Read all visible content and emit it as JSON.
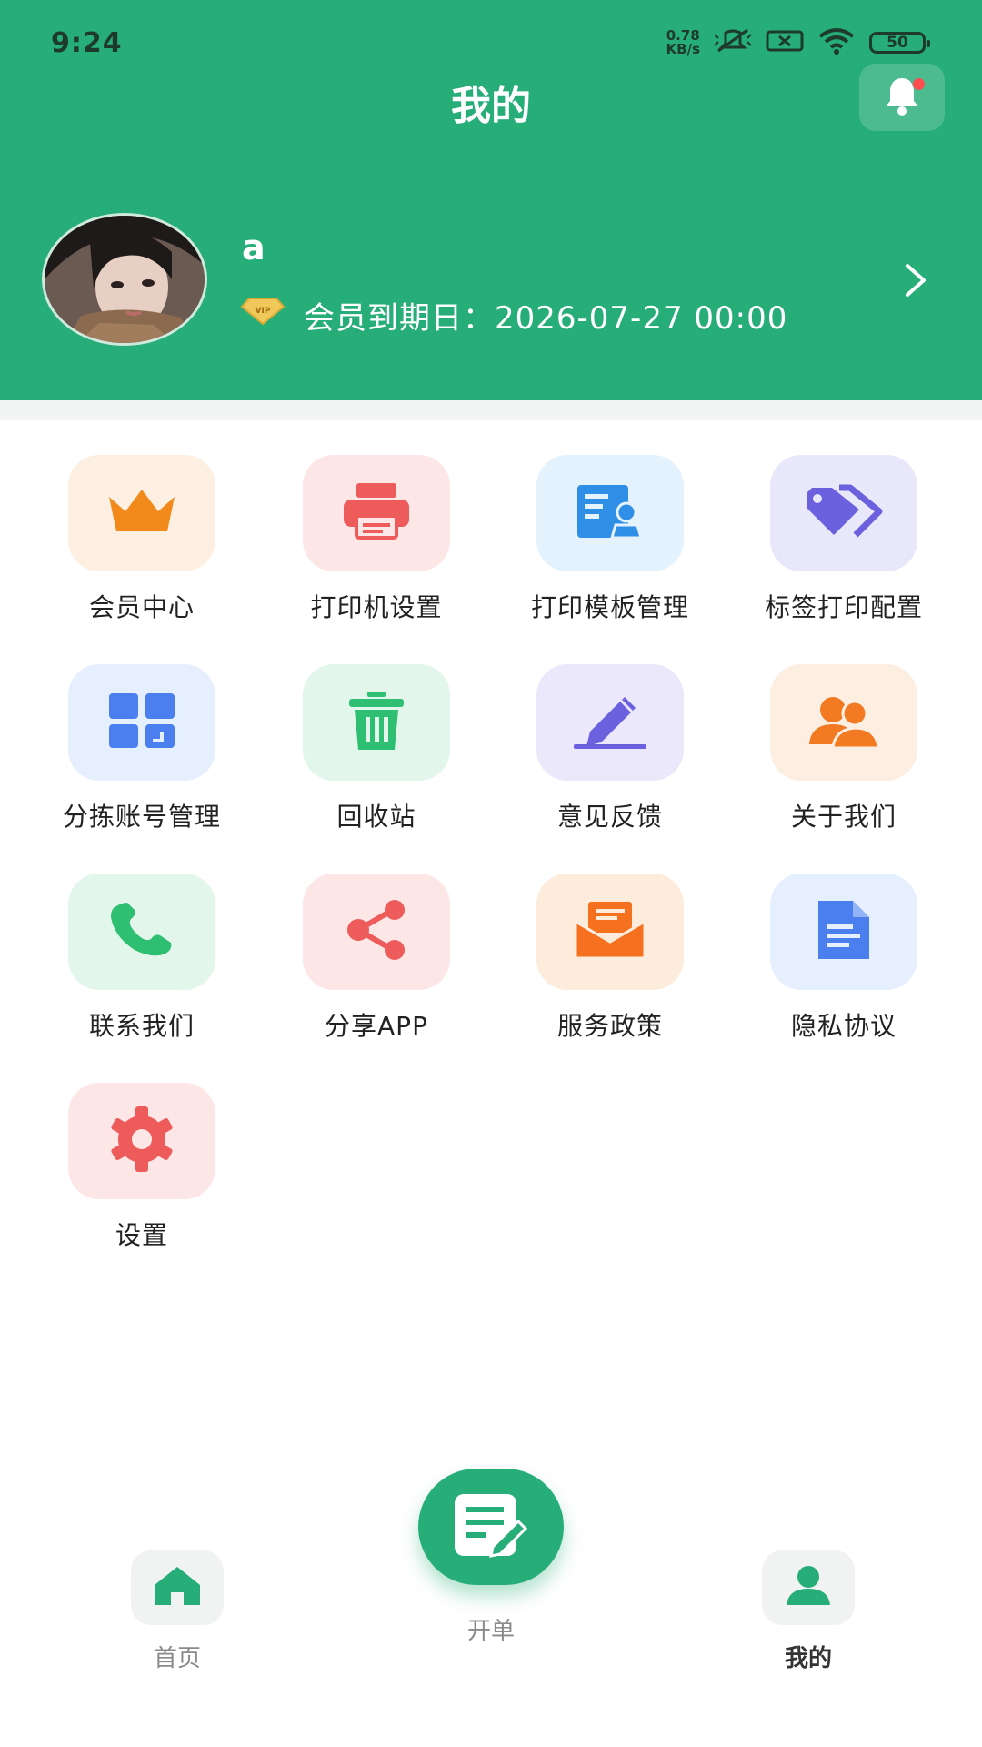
{
  "status_bar": {
    "time": "9:24",
    "net_speed_value": "0.78",
    "net_speed_unit": "KB/s",
    "battery": "50"
  },
  "header": {
    "title": "我的",
    "notification_dot": true
  },
  "profile": {
    "username": "a",
    "vip_label": "VIP",
    "member_expiry": "会员到期日：2026-07-27 00:00"
  },
  "menu": [
    {
      "label": "会员中心",
      "icon": "crown-icon",
      "tile_bg": "#fdf0e2",
      "color": "#f28a1b"
    },
    {
      "label": "打印机设置",
      "icon": "printer-icon",
      "tile_bg": "#fde6e6",
      "color": "#ee5b5b"
    },
    {
      "label": "打印模板管理",
      "icon": "template-icon",
      "tile_bg": "#e4f2fd",
      "color": "#2f8ee6"
    },
    {
      "label": "标签打印配置",
      "icon": "tags-icon",
      "tile_bg": "#e9e8fb",
      "color": "#6b61de"
    },
    {
      "label": "分拣账号管理",
      "icon": "grid-icon",
      "tile_bg": "#e6effd",
      "color": "#4b7ff0"
    },
    {
      "label": "回收站",
      "icon": "trash-icon",
      "tile_bg": "#e3f6ec",
      "color": "#2fbf72"
    },
    {
      "label": "意见反馈",
      "icon": "feedback-pen-icon",
      "tile_bg": "#ebe8fb",
      "color": "#6b61de"
    },
    {
      "label": "关于我们",
      "icon": "users-icon",
      "tile_bg": "#fdeee2",
      "color": "#f27a22"
    },
    {
      "label": "联系我们",
      "icon": "phone-icon",
      "tile_bg": "#e3f6ec",
      "color": "#2fbf72"
    },
    {
      "label": "分享APP",
      "icon": "share-icon",
      "tile_bg": "#fde6e6",
      "color": "#ee5b5b"
    },
    {
      "label": "服务政策",
      "icon": "envelope-icon",
      "tile_bg": "#fdebdc",
      "color": "#f6711f"
    },
    {
      "label": "隐私协议",
      "icon": "document-icon",
      "tile_bg": "#e6effd",
      "color": "#4b7ff0"
    },
    {
      "label": "设置",
      "icon": "gear-icon",
      "tile_bg": "#fde6e6",
      "color": "#ee5b5b"
    }
  ],
  "bottom_nav": {
    "home_label": "首页",
    "order_label": "开单",
    "mine_label": "我的",
    "active": "我的"
  },
  "colors": {
    "brand": "#26ad78"
  }
}
